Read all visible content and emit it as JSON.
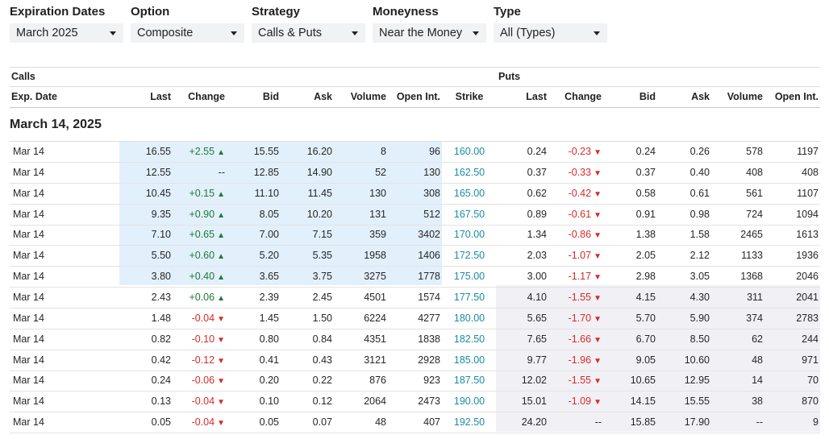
{
  "filters": [
    {
      "label": "Expiration Dates",
      "value": "March 2025"
    },
    {
      "label": "Option",
      "value": "Composite"
    },
    {
      "label": "Strategy",
      "value": "Calls & Puts"
    },
    {
      "label": "Moneyness",
      "value": "Near the Money"
    },
    {
      "label": "Type",
      "value": "All (Types)"
    }
  ],
  "table": {
    "calls_label": "Calls",
    "puts_label": "Puts",
    "headers": {
      "exp": "Exp. Date",
      "c_last": "Last",
      "c_change": "Change",
      "c_bid": "Bid",
      "c_ask": "Ask",
      "c_volume": "Volume",
      "c_oi": "Open Int.",
      "strike": "Strike",
      "p_last": "Last",
      "p_change": "Change",
      "p_bid": "Bid",
      "p_ask": "Ask",
      "p_volume": "Volume",
      "p_oi": "Open Int."
    },
    "section_title": "March 14, 2025",
    "rows": [
      {
        "exp": "Mar 14",
        "c_last": "16.55",
        "c_change": "+2.55",
        "c_dir": "up",
        "c_bid": "15.55",
        "c_ask": "16.20",
        "c_vol": "8",
        "c_oi": "96",
        "strike": "160.00",
        "p_last": "0.24",
        "p_change": "-0.23",
        "p_dir": "down",
        "p_bid": "0.24",
        "p_ask": "0.26",
        "p_vol": "578",
        "p_oi": "1197"
      },
      {
        "exp": "Mar 14",
        "c_last": "12.55",
        "c_change": "--",
        "c_dir": "none",
        "c_bid": "12.85",
        "c_ask": "14.90",
        "c_vol": "52",
        "c_oi": "130",
        "strike": "162.50",
        "p_last": "0.37",
        "p_change": "-0.33",
        "p_dir": "down",
        "p_bid": "0.37",
        "p_ask": "0.40",
        "p_vol": "408",
        "p_oi": "408"
      },
      {
        "exp": "Mar 14",
        "c_last": "10.45",
        "c_change": "+0.15",
        "c_dir": "up",
        "c_bid": "11.10",
        "c_ask": "11.45",
        "c_vol": "130",
        "c_oi": "308",
        "strike": "165.00",
        "p_last": "0.62",
        "p_change": "-0.42",
        "p_dir": "down",
        "p_bid": "0.58",
        "p_ask": "0.61",
        "p_vol": "561",
        "p_oi": "1107"
      },
      {
        "exp": "Mar 14",
        "c_last": "9.35",
        "c_change": "+0.90",
        "c_dir": "up",
        "c_bid": "8.05",
        "c_ask": "10.20",
        "c_vol": "131",
        "c_oi": "512",
        "strike": "167.50",
        "p_last": "0.89",
        "p_change": "-0.61",
        "p_dir": "down",
        "p_bid": "0.91",
        "p_ask": "0.98",
        "p_vol": "724",
        "p_oi": "1094"
      },
      {
        "exp": "Mar 14",
        "c_last": "7.10",
        "c_change": "+0.65",
        "c_dir": "up",
        "c_bid": "7.00",
        "c_ask": "7.15",
        "c_vol": "359",
        "c_oi": "3402",
        "strike": "170.00",
        "p_last": "1.34",
        "p_change": "-0.86",
        "p_dir": "down",
        "p_bid": "1.38",
        "p_ask": "1.58",
        "p_vol": "2465",
        "p_oi": "1613"
      },
      {
        "exp": "Mar 14",
        "c_last": "5.50",
        "c_change": "+0.60",
        "c_dir": "up",
        "c_bid": "5.20",
        "c_ask": "5.35",
        "c_vol": "1958",
        "c_oi": "1406",
        "strike": "172.50",
        "p_last": "2.03",
        "p_change": "-1.07",
        "p_dir": "down",
        "p_bid": "2.05",
        "p_ask": "2.12",
        "p_vol": "1133",
        "p_oi": "1936"
      },
      {
        "exp": "Mar 14",
        "c_last": "3.80",
        "c_change": "+0.40",
        "c_dir": "up",
        "c_bid": "3.65",
        "c_ask": "3.75",
        "c_vol": "3275",
        "c_oi": "1778",
        "strike": "175.00",
        "p_last": "3.00",
        "p_change": "-1.17",
        "p_dir": "down",
        "p_bid": "2.98",
        "p_ask": "3.05",
        "p_vol": "1368",
        "p_oi": "2046"
      },
      {
        "exp": "Mar 14",
        "c_last": "2.43",
        "c_change": "+0.06",
        "c_dir": "up",
        "c_bid": "2.39",
        "c_ask": "2.45",
        "c_vol": "4501",
        "c_oi": "1574",
        "strike": "177.50",
        "p_last": "4.10",
        "p_change": "-1.55",
        "p_dir": "down",
        "p_bid": "4.15",
        "p_ask": "4.30",
        "p_vol": "311",
        "p_oi": "2041"
      },
      {
        "exp": "Mar 14",
        "c_last": "1.48",
        "c_change": "-0.04",
        "c_dir": "down",
        "c_bid": "1.45",
        "c_ask": "1.50",
        "c_vol": "6224",
        "c_oi": "4277",
        "strike": "180.00",
        "p_last": "5.65",
        "p_change": "-1.70",
        "p_dir": "down",
        "p_bid": "5.70",
        "p_ask": "5.90",
        "p_vol": "374",
        "p_oi": "2783"
      },
      {
        "exp": "Mar 14",
        "c_last": "0.82",
        "c_change": "-0.10",
        "c_dir": "down",
        "c_bid": "0.80",
        "c_ask": "0.84",
        "c_vol": "4351",
        "c_oi": "1838",
        "strike": "182.50",
        "p_last": "7.65",
        "p_change": "-1.66",
        "p_dir": "down",
        "p_bid": "6.70",
        "p_ask": "8.50",
        "p_vol": "62",
        "p_oi": "244"
      },
      {
        "exp": "Mar 14",
        "c_last": "0.42",
        "c_change": "-0.12",
        "c_dir": "down",
        "c_bid": "0.41",
        "c_ask": "0.43",
        "c_vol": "3121",
        "c_oi": "2928",
        "strike": "185.00",
        "p_last": "9.77",
        "p_change": "-1.96",
        "p_dir": "down",
        "p_bid": "9.05",
        "p_ask": "10.60",
        "p_vol": "48",
        "p_oi": "971"
      },
      {
        "exp": "Mar 14",
        "c_last": "0.24",
        "c_change": "-0.06",
        "c_dir": "down",
        "c_bid": "0.20",
        "c_ask": "0.22",
        "c_vol": "876",
        "c_oi": "923",
        "strike": "187.50",
        "p_last": "12.02",
        "p_change": "-1.55",
        "p_dir": "down",
        "p_bid": "10.65",
        "p_ask": "12.95",
        "p_vol": "14",
        "p_oi": "70"
      },
      {
        "exp": "Mar 14",
        "c_last": "0.13",
        "c_change": "-0.04",
        "c_dir": "down",
        "c_bid": "0.10",
        "c_ask": "0.12",
        "c_vol": "2064",
        "c_oi": "2473",
        "strike": "190.00",
        "p_last": "15.01",
        "p_change": "-1.09",
        "p_dir": "down",
        "p_bid": "14.15",
        "p_ask": "15.55",
        "p_vol": "38",
        "p_oi": "870"
      },
      {
        "exp": "Mar 14",
        "c_last": "0.05",
        "c_change": "-0.04",
        "c_dir": "down",
        "c_bid": "0.05",
        "c_ask": "0.07",
        "c_vol": "48",
        "c_oi": "407",
        "strike": "192.50",
        "p_last": "24.20",
        "p_change": "--",
        "p_dir": "none",
        "p_bid": "15.85",
        "p_ask": "17.90",
        "p_vol": "--",
        "p_oi": "9"
      }
    ]
  },
  "colors": {
    "up": "#1e7a35",
    "down": "#d62b2b",
    "strike": "#1a8ca0",
    "itm_calls": "#e2f0fc",
    "itm_puts": "#f1f0f4"
  },
  "icons": {
    "dropdown": "chevron-down-icon",
    "up": "triangle-up-icon",
    "down": "triangle-down-icon"
  }
}
